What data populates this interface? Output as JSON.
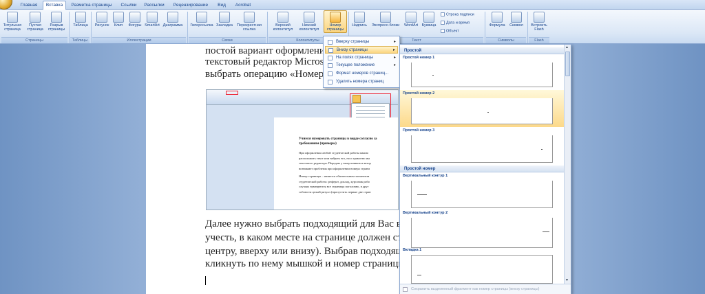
{
  "tabs": [
    "Главная",
    "Вставка",
    "Разметка страницы",
    "Ссылки",
    "Рассылки",
    "Рецензирование",
    "Вид",
    "Acrobat"
  ],
  "ribbon": {
    "buttons": [
      "Титульная страница",
      "Пустая страница",
      "Разрыв страницы",
      "Таблица",
      "Рисунок",
      "Клип",
      "Фигуры",
      "SmartArt",
      "Диаграмма",
      "Гиперссылка",
      "Закладка",
      "Перекрестная ссылка",
      "Верхний колонтитул",
      "Нижний колонтитул",
      "Номер страницы",
      "Надпись",
      "Экспресс-блоки",
      "WordArt",
      "Буквица",
      "Формула",
      "Символ",
      "Встроить Flash"
    ],
    "small_buttons": [
      "Строка подписи",
      "Дата и время",
      "Объект"
    ],
    "groups": [
      "Страницы",
      "Таблицы",
      "Иллюстрации",
      "Связи",
      "Колонтитулы",
      "Текст",
      "Символы",
      "Flash"
    ]
  },
  "document": {
    "line1": "постой вариант оформления т",
    "line2": "текстовый редактор Microsof",
    "line3": "выбрать операцию «Номер ст",
    "para2": [
      "Далее нужно выбрать подходящий для Вас вари",
      "учесть, в каком месте на странице должен стоят",
      "центру, вверху или внизу). Выбрав подходящее",
      "кликнуть по нему мышкой и номер страницы п"
    ],
    "shot_title": [
      "Учимся нумеровать страницы в ворде согласно за",
      "требованиям (примеры)"
    ],
    "shot_body": [
      "При оформлении любой студенческой работы важно",
      "расположить текст или набрать его, но и грамотно им",
      "текстового редактора. Передаю у выпускников и автор",
      "возникают проблемы при оформлении номера страни",
      "",
      "Номер страницы – является обязательным элементом",
      "студенческой работы: реферат, доклад, курсовик рабо",
      "случаях нумеруются все страницы поголовно, в друг",
      "соблюсти целый ритуал (пропустить первые две стран"
    ]
  },
  "menu": [
    {
      "label": "Вверху страницы",
      "arrow": "▸"
    },
    {
      "label": "Внизу страницы",
      "arrow": "▸"
    },
    {
      "label": "На полях страницы",
      "arrow": "▸"
    },
    {
      "label": "Текущее положение",
      "arrow": "▸"
    },
    {
      "label": "Формат номеров страниц...",
      "arrow": ""
    },
    {
      "label": "Удалить номера страниц",
      "arrow": ""
    }
  ],
  "gallery": {
    "header1": "Простой",
    "items1": [
      "Простой номер 1",
      "Простой номер 2",
      "Простой номер 3"
    ],
    "header2": "Простой номер",
    "items2": [
      "Вертикальный контур 1",
      "Вертикальный контур 2",
      "Вкладка 1"
    ],
    "footer": "Сохранить выделенный фрагмент как номер страницы (внизу страницы)"
  }
}
